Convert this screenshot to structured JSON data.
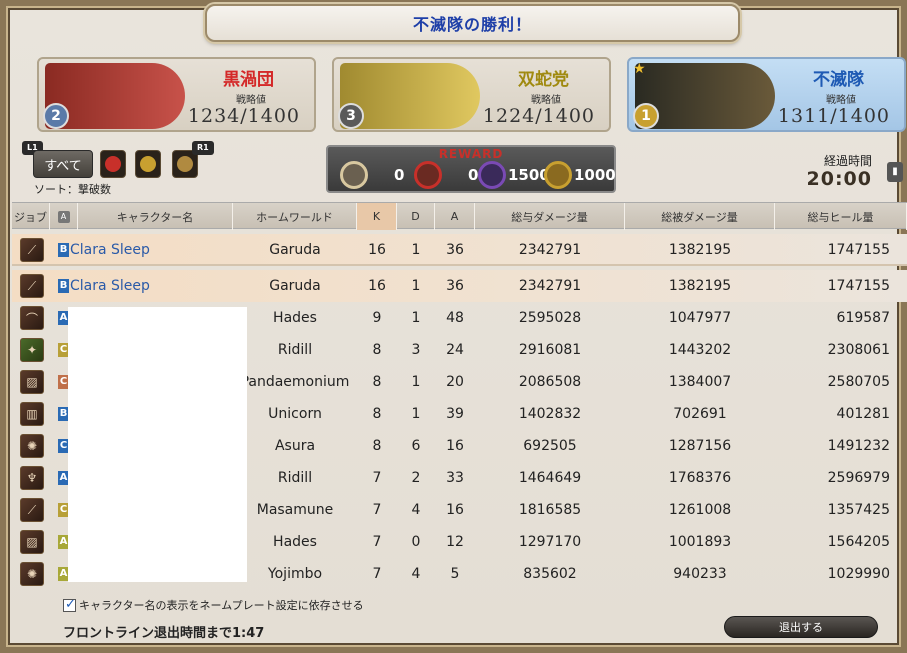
{
  "title": "不滅隊の勝利！",
  "teams": [
    {
      "name": "黒渦団",
      "name_color": "#d42828",
      "strategy_label": "戦略値",
      "score": "1234/1400",
      "rank": "2",
      "flag_color": "#b8423a",
      "badge_color": "#5a7aa8"
    },
    {
      "name": "双蛇党",
      "name_color": "#a08a10",
      "strategy_label": "戦略値",
      "score": "1224/1400",
      "rank": "3",
      "flag_color": "#d4b84a",
      "badge_color": "#5a5a5a"
    },
    {
      "name": "不滅隊",
      "name_color": "#1e5ab4",
      "strategy_label": "戦略値",
      "score": "1311/1400",
      "rank": "1",
      "flag_color": "#4a4a3a",
      "badge_color": "#c8a030"
    }
  ],
  "controls": {
    "l1": "L1",
    "r1": "R1",
    "all_button": "すべて",
    "sort_label": "ソート：撃破数"
  },
  "reward": {
    "title": "REWARD",
    "items": [
      {
        "icon": "silver-wolf-mark-icon",
        "value": "0",
        "color": "#d8c8a0"
      },
      {
        "icon": "red-wolf-mark-icon",
        "value": "0",
        "color": "#c8302a"
      },
      {
        "icon": "purple-wolf-mark-icon",
        "value": "1500",
        "color": "#7a4ab4"
      },
      {
        "icon": "gold-seal-icon",
        "value": "1000",
        "color": "#c8a030"
      }
    ]
  },
  "elapsed": {
    "label": "経過時間",
    "time": "20:00"
  },
  "table": {
    "headers": {
      "job": "ジョブ",
      "alliance": "A",
      "name": "キャラクター名",
      "world": "ホームワールド",
      "k": "K",
      "d": "D",
      "a": "A",
      "damage": "総与ダメージ量",
      "taken": "総被ダメージ量",
      "heal": "総与ヒール量"
    },
    "pinned": {
      "job_icon": "dancer-icon",
      "alliance": "B",
      "name": "Clara Sleep",
      "world": "Garuda",
      "k": "16",
      "d": "1",
      "a": "36",
      "damage": "2342791",
      "taken": "1382195",
      "heal": "1747155"
    },
    "rows": [
      {
        "job_icon": "dancer-icon",
        "alliance": "B",
        "name": "Clara Sleep",
        "world": "Garuda",
        "k": "16",
        "d": "1",
        "a": "36",
        "damage": "2342791",
        "taken": "1382195",
        "heal": "1747155"
      },
      {
        "job_icon": "bard-icon",
        "alliance": "A",
        "name": "",
        "world": "Hades",
        "k": "9",
        "d": "1",
        "a": "48",
        "damage": "2595028",
        "taken": "1047977",
        "heal": "619587"
      },
      {
        "job_icon": "sage-icon",
        "alliance": "C",
        "name": "",
        "world": "Ridill",
        "k": "8",
        "d": "3",
        "a": "24",
        "damage": "2916081",
        "taken": "1443202",
        "heal": "2308061"
      },
      {
        "job_icon": "ninja-icon",
        "alliance": "C",
        "name": "",
        "world": "Pandaemonium",
        "k": "8",
        "d": "1",
        "a": "20",
        "damage": "2086508",
        "taken": "1384007",
        "heal": "2580705"
      },
      {
        "job_icon": "scholar-icon",
        "alliance": "B",
        "name": "",
        "world": "Unicorn",
        "k": "8",
        "d": "1",
        "a": "39",
        "damage": "1402832",
        "taken": "702691",
        "heal": "401281"
      },
      {
        "job_icon": "astrologian-icon",
        "alliance": "C",
        "name": "",
        "world": "Asura",
        "k": "8",
        "d": "6",
        "a": "16",
        "damage": "692505",
        "taken": "1287156",
        "heal": "1491232"
      },
      {
        "job_icon": "reaper-icon",
        "alliance": "A",
        "name": "",
        "world": "Ridill",
        "k": "7",
        "d": "2",
        "a": "33",
        "damage": "1464649",
        "taken": "1768376",
        "heal": "2596979"
      },
      {
        "job_icon": "dancer-icon",
        "alliance": "C",
        "name": "",
        "world": "Masamune",
        "k": "7",
        "d": "4",
        "a": "16",
        "damage": "1816585",
        "taken": "1261008",
        "heal": "1357425"
      },
      {
        "job_icon": "ninja-icon",
        "alliance": "A",
        "name": "",
        "world": "Hades",
        "k": "7",
        "d": "0",
        "a": "12",
        "damage": "1297170",
        "taken": "1001893",
        "heal": "1564205"
      },
      {
        "job_icon": "astrologian-icon",
        "alliance": "A",
        "name": "",
        "world": "Yojimbo",
        "k": "7",
        "d": "4",
        "a": "5",
        "damage": "835602",
        "taken": "940233",
        "heal": "1029990"
      }
    ]
  },
  "footer": {
    "checkbox_label": "キャラクター名の表示をネームプレート設定に依存させる",
    "checkbox_checked": true,
    "leave_timer": "フロントライン退出時間まで1:47",
    "exit_button": "退出する"
  }
}
